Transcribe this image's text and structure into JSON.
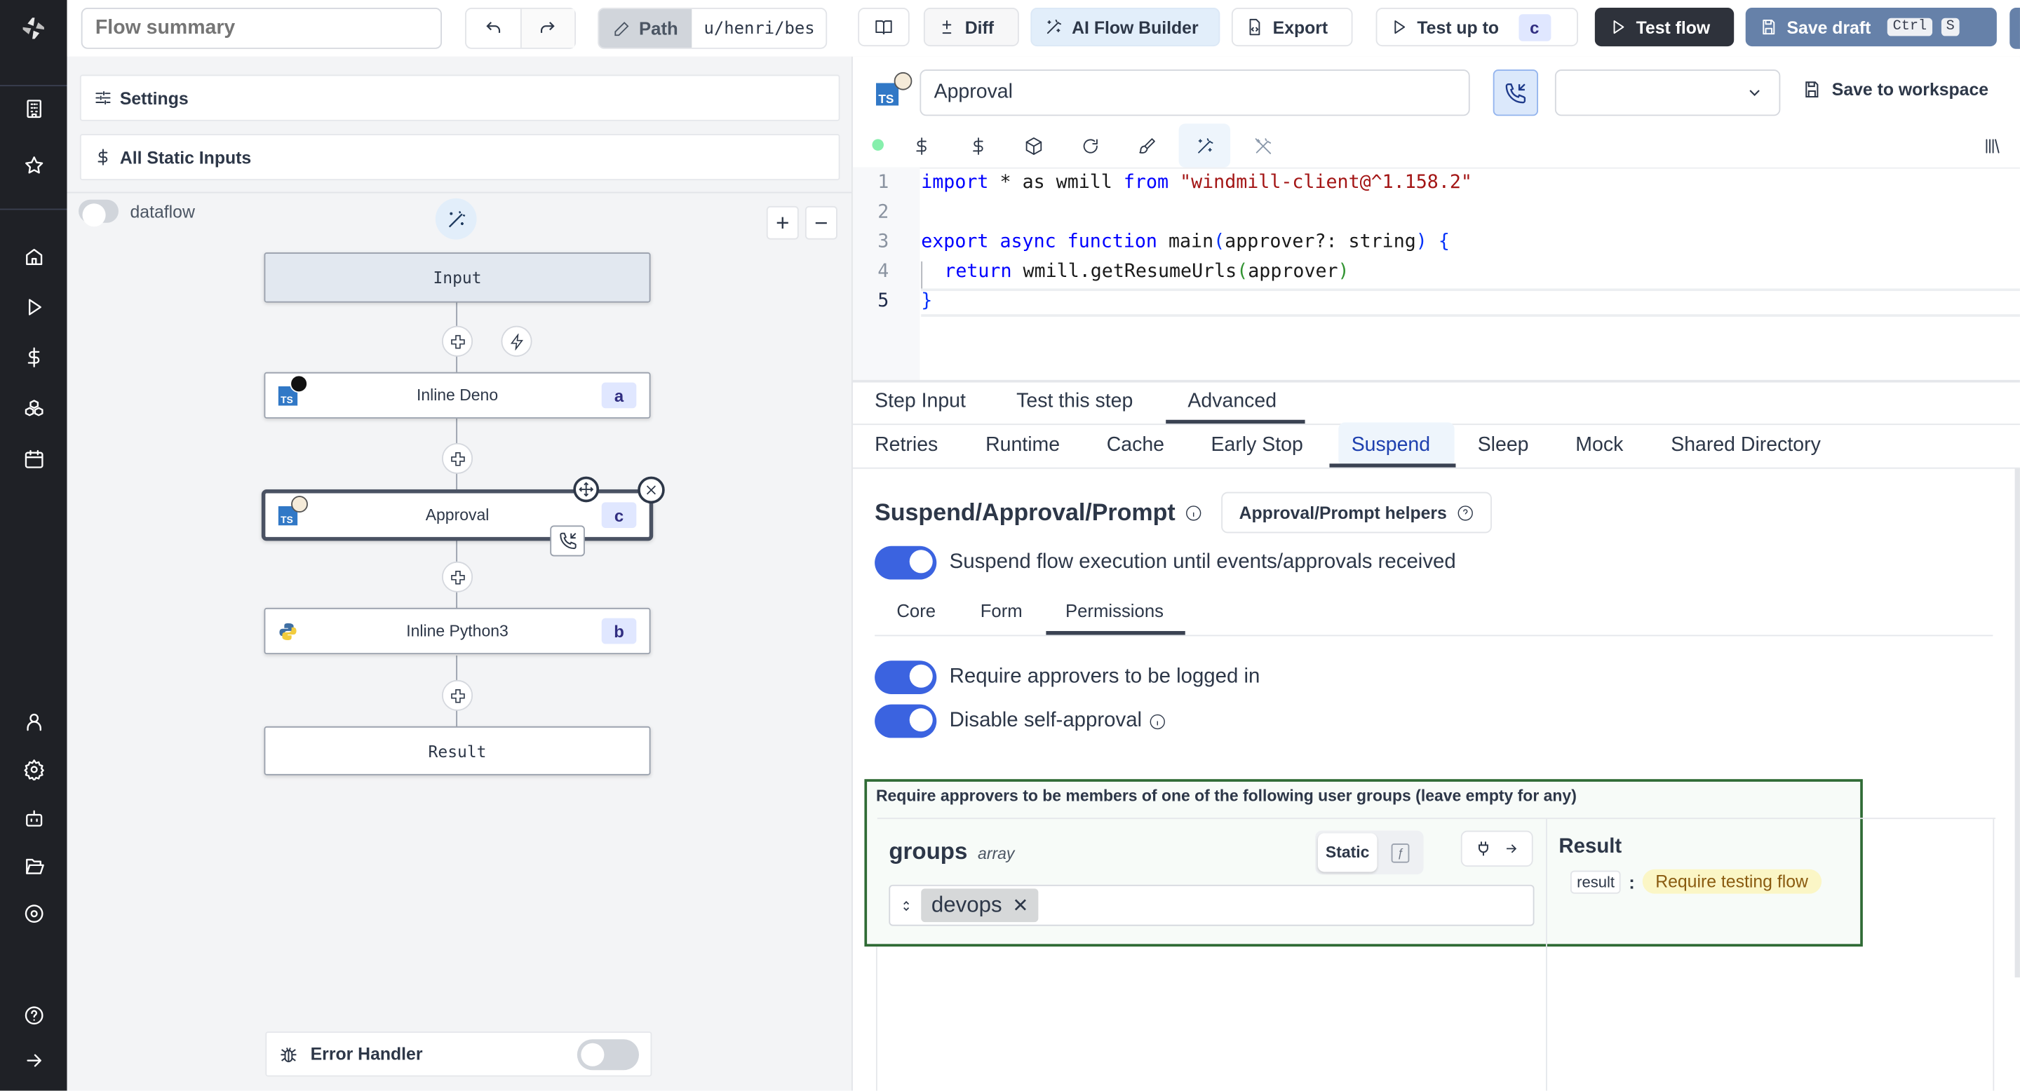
{
  "rail": {
    "icons": [
      "windmill-logo-icon",
      "building-icon",
      "star-icon",
      "home-icon",
      "play-icon",
      "dollar-icon",
      "boxes-icon",
      "calendar-icon",
      "user-icon",
      "gear-icon",
      "bot-icon",
      "folder-open-icon",
      "eye-icon",
      "help-icon",
      "arrow-right-icon"
    ]
  },
  "topbar": {
    "summary_placeholder": "Flow summary",
    "path_label": "Path",
    "path_value": "u/henri/bes",
    "diff_label": "Diff",
    "ai_builder_label": "AI Flow Builder",
    "export_label": "Export",
    "test_up_to_label": "Test up to",
    "test_up_to_step": "c",
    "test_flow_label": "Test flow",
    "save_draft_label": "Save draft",
    "save_draft_kbd1": "Ctrl",
    "save_draft_kbd2": "S"
  },
  "left": {
    "settings_label": "Settings",
    "static_inputs_label": "All Static Inputs",
    "dataflow_label": "dataflow",
    "dataflow_on": false,
    "nodes": [
      {
        "label": "Input",
        "type": "input"
      },
      {
        "label": "Inline Deno",
        "id": "a",
        "lang": "TS"
      },
      {
        "label": "Approval",
        "id": "c",
        "lang": "TS",
        "selected": true
      },
      {
        "label": "Inline Python3",
        "id": "b",
        "lang": "python"
      },
      {
        "label": "Result",
        "type": "result"
      }
    ],
    "error_handler_label": "Error Handler",
    "error_handler_on": false
  },
  "editor": {
    "step_name": "Approval",
    "lang_badge": "TS",
    "select_value": "",
    "save_to_workspace_label": "Save to workspace",
    "code_lines": [
      {
        "n": "1"
      },
      {
        "n": "2"
      },
      {
        "n": "3"
      },
      {
        "n": "4"
      },
      {
        "n": "5"
      }
    ],
    "code": {
      "l1_import": "import",
      "l1_mid": " * as wmill ",
      "l1_from": "from",
      "l1_str": " \"windmill-client@^1.158.2\"",
      "l3_export": "export async function",
      "l3_main": " main",
      "l3_open": "(",
      "l3_args": "approver?: string",
      "l3_close": ")",
      "l3_brace": " {",
      "l4_return": "return",
      "l4_call": " wmill.getResumeUrls",
      "l4_open": "(",
      "l4_arg": "approver",
      "l4_close": ")",
      "l5_brace": "}"
    }
  },
  "tabs": {
    "main": [
      "Step Input",
      "Test this step",
      "Advanced"
    ],
    "main_active": "Advanced",
    "advanced": [
      "Retries",
      "Runtime",
      "Cache",
      "Early Stop",
      "Suspend",
      "Sleep",
      "Mock",
      "Shared Directory"
    ],
    "advanced_active": "Suspend"
  },
  "suspend": {
    "title": "Suspend/Approval/Prompt",
    "helpers_label": "Approval/Prompt helpers",
    "suspend_toggle_label": "Suspend flow execution until events/approvals received",
    "suspend_on": true,
    "subtabs": [
      "Core",
      "Form",
      "Permissions"
    ],
    "subtab_active": "Permissions",
    "require_logged_in_label": "Require approvers to be logged in",
    "require_logged_in_on": true,
    "disable_self_approval_label": "Disable self-approval",
    "disable_self_approval_on": true,
    "groups_section_label": "Require approvers to be members of one of the following user groups (leave empty for any)",
    "groups_name": "groups",
    "groups_type": "array",
    "static_label": "Static",
    "groups_values": [
      "devops"
    ],
    "result_title": "Result",
    "result_key": "result",
    "result_value": "Require testing flow"
  },
  "colors": {
    "accent": "#3b63e0",
    "rail_bg": "#1f2126",
    "test_flow_bg": "#2e323b",
    "save_draft_bg": "#6681a9",
    "highlight_border": "#2f6b35"
  }
}
